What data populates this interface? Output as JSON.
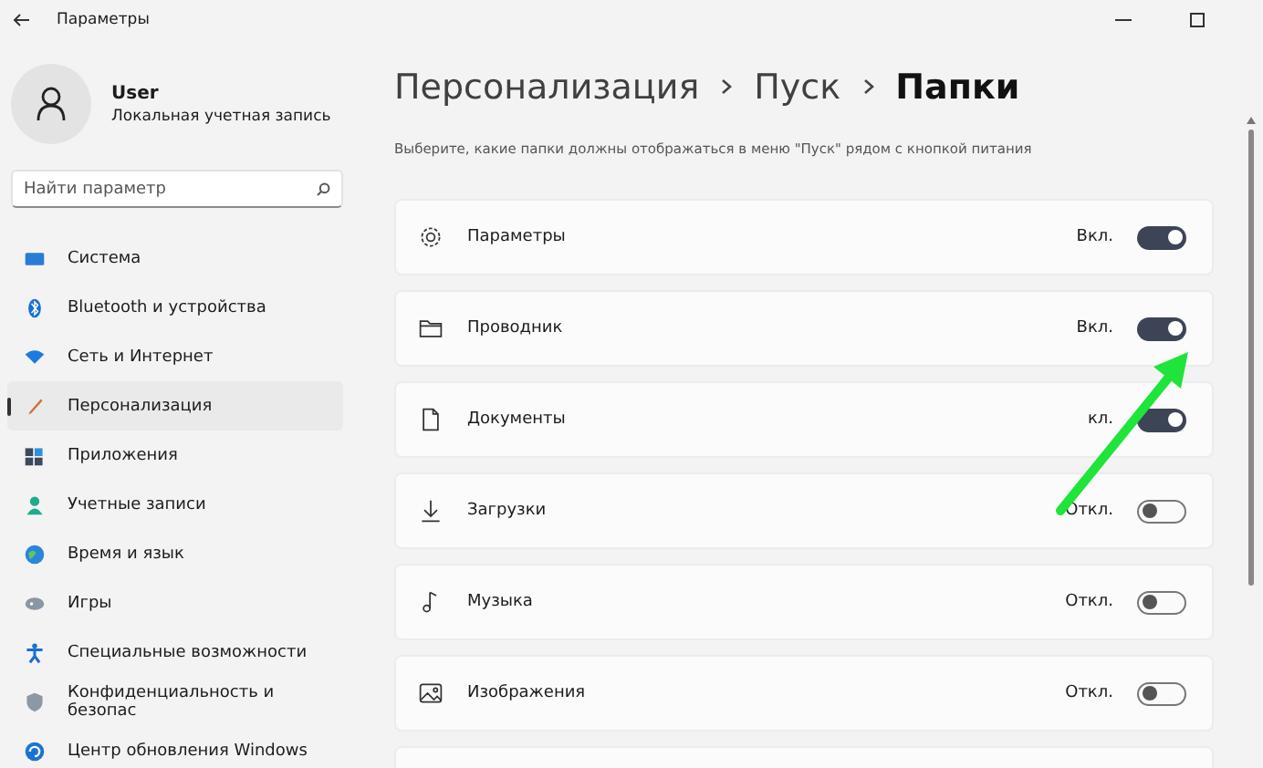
{
  "window": {
    "title": "Параметры"
  },
  "user": {
    "name": "User",
    "account": "Локальная учетная запись"
  },
  "search": {
    "placeholder": "Найти параметр"
  },
  "nav": [
    {
      "label": "Система",
      "selected": false
    },
    {
      "label": "Bluetooth и устройства",
      "selected": false
    },
    {
      "label": "Сеть и Интернет",
      "selected": false
    },
    {
      "label": "Персонализация",
      "selected": true
    },
    {
      "label": "Приложения",
      "selected": false
    },
    {
      "label": "Учетные записи",
      "selected": false
    },
    {
      "label": "Время и язык",
      "selected": false
    },
    {
      "label": "Игры",
      "selected": false
    },
    {
      "label": "Специальные возможности",
      "selected": false
    },
    {
      "label": "Конфиденциальность и безопас",
      "selected": false
    },
    {
      "label": "Центр обновления Windows",
      "selected": false
    }
  ],
  "breadcrumb": [
    "Персонализация",
    "Пуск",
    "Папки"
  ],
  "description": "Выберите, какие папки должны отображаться в меню \"Пуск\" рядом с кнопкой питания",
  "folders": [
    {
      "label": "Параметры",
      "state_label": "Вкл.",
      "on": true
    },
    {
      "label": "Проводник",
      "state_label": "Вкл.",
      "on": true
    },
    {
      "label": "Документы",
      "state_label": "кл.",
      "on": true
    },
    {
      "label": "Загрузки",
      "state_label": "Откл.",
      "on": false
    },
    {
      "label": "Музыка",
      "state_label": "Откл.",
      "on": false
    },
    {
      "label": "Изображения",
      "state_label": "Откл.",
      "on": false
    }
  ]
}
